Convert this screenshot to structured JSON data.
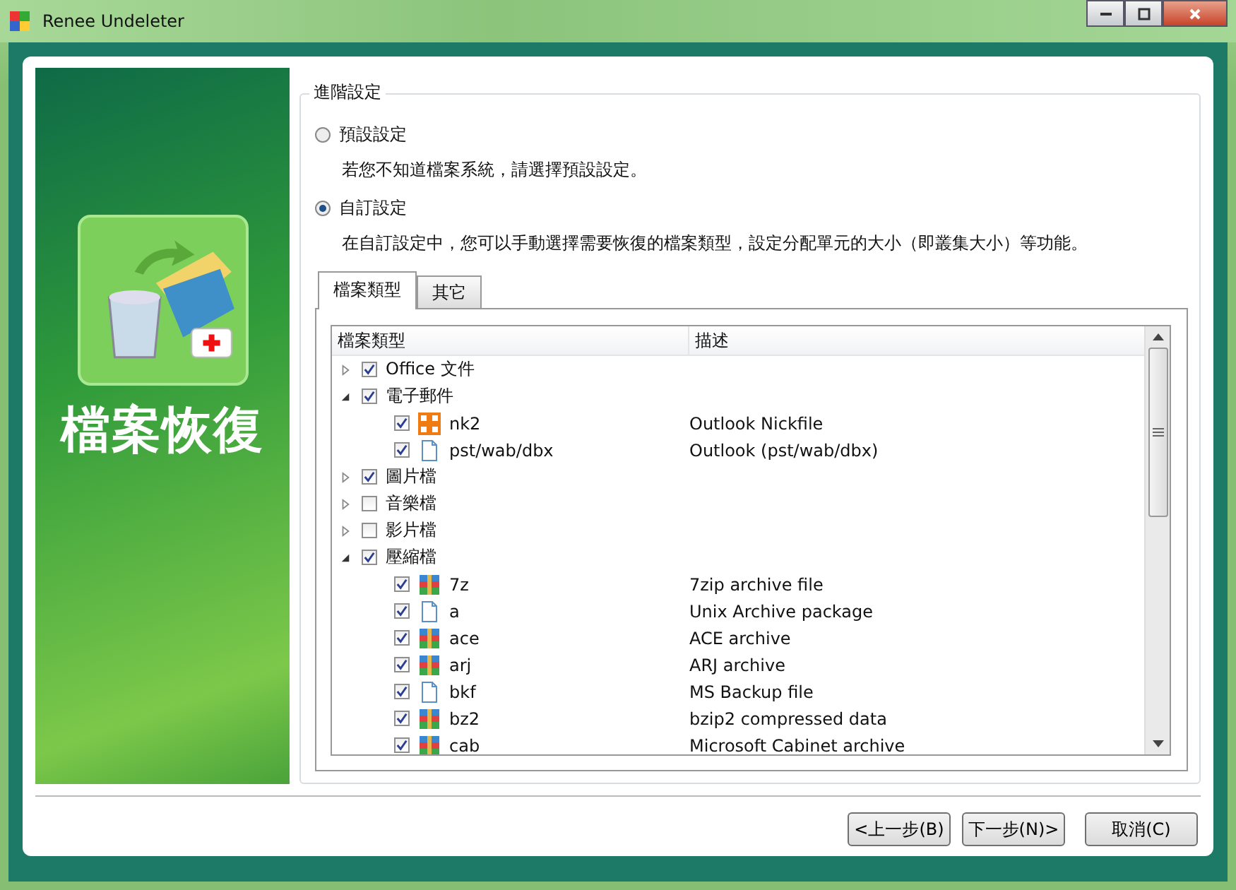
{
  "window": {
    "title": "Renee Undeleter"
  },
  "sidebar": {
    "title": "檔案恢復"
  },
  "group": {
    "title": "進階設定",
    "options": [
      {
        "label": "預設設定",
        "description": "若您不知道檔案系統，請選擇預設設定。",
        "selected": false
      },
      {
        "label": "自訂設定",
        "description": "在自訂設定中，您可以手動選擇需要恢復的檔案類型，設定分配單元的大小（即叢集大小）等功能。",
        "selected": true
      }
    ]
  },
  "tabs": [
    {
      "label": "檔案類型",
      "selected": true
    },
    {
      "label": "其它",
      "selected": false
    }
  ],
  "table": {
    "columns": [
      "檔案類型",
      "描述"
    ],
    "rows": [
      {
        "name": "Office 文件",
        "checked": true,
        "expanded": false,
        "children": []
      },
      {
        "name": "電子郵件",
        "checked": true,
        "expanded": true,
        "children": [
          {
            "name": "nk2",
            "description": "Outlook Nickfile",
            "kind": "office",
            "checked": true
          },
          {
            "name": "pst/wab/dbx",
            "description": "Outlook (pst/wab/dbx)",
            "kind": "file",
            "checked": true
          }
        ]
      },
      {
        "name": "圖片檔",
        "checked": true,
        "expanded": false,
        "children": []
      },
      {
        "name": "音樂檔",
        "checked": false,
        "expanded": false,
        "children": []
      },
      {
        "name": "影片檔",
        "checked": false,
        "expanded": false,
        "children": []
      },
      {
        "name": "壓縮檔",
        "checked": true,
        "expanded": true,
        "children": [
          {
            "name": "7z",
            "description": "7zip archive file",
            "kind": "archive",
            "checked": true
          },
          {
            "name": "a",
            "description": "Unix Archive package",
            "kind": "file",
            "checked": true
          },
          {
            "name": "ace",
            "description": "ACE archive",
            "kind": "archive",
            "checked": true
          },
          {
            "name": "arj",
            "description": "ARJ archive",
            "kind": "archive",
            "checked": true
          },
          {
            "name": "bkf",
            "description": "MS Backup file",
            "kind": "file",
            "checked": true
          },
          {
            "name": "bz2",
            "description": "bzip2 compressed data",
            "kind": "archive",
            "checked": true
          },
          {
            "name": "cab",
            "description": "Microsoft Cabinet archive",
            "kind": "archive",
            "checked": true
          }
        ]
      }
    ]
  },
  "buttons": [
    "<上一步(B)",
    "下一步(N)>",
    "取消(C)"
  ]
}
